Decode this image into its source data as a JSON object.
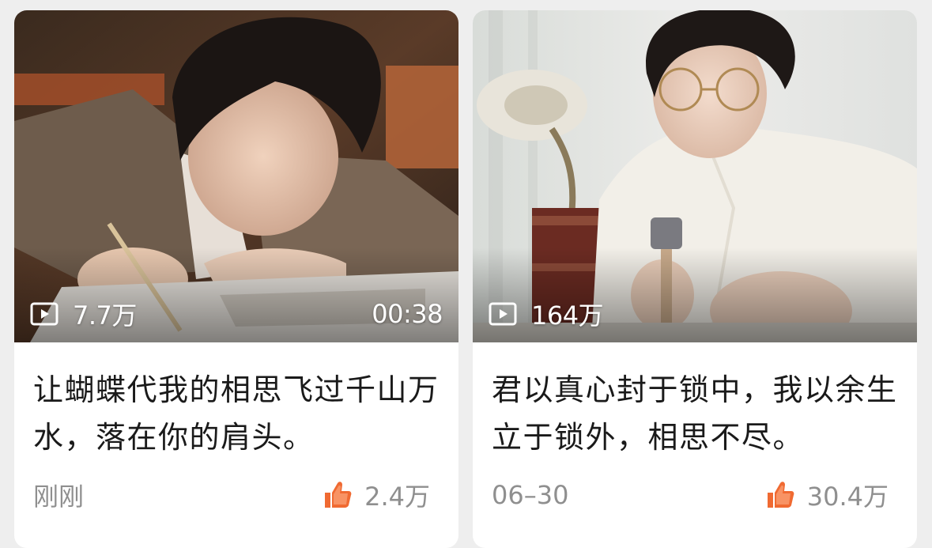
{
  "cards": [
    {
      "views": "7.7万",
      "duration": "00:38",
      "title": "让蝴蝶代我的相思飞过千山万水，落在你的肩头。",
      "time": "刚刚",
      "likes": "2.4万",
      "icons": {
        "views": "play-icon",
        "likes": "thumbs-up-icon"
      },
      "image_description": "man writing at desk"
    },
    {
      "views": "164万",
      "title": "君以真心封于锁中，我以余生立于锁外，相思不尽。",
      "time": "06–30",
      "likes": "30.4万",
      "icons": {
        "views": "play-icon",
        "likes": "thumbs-up-icon"
      },
      "image_description": "man with glasses crafting with hammer"
    }
  ],
  "colors": {
    "like_icon": "#f06a32",
    "secondary_text": "#8f8f8f",
    "title_text": "#1a1a1a"
  }
}
